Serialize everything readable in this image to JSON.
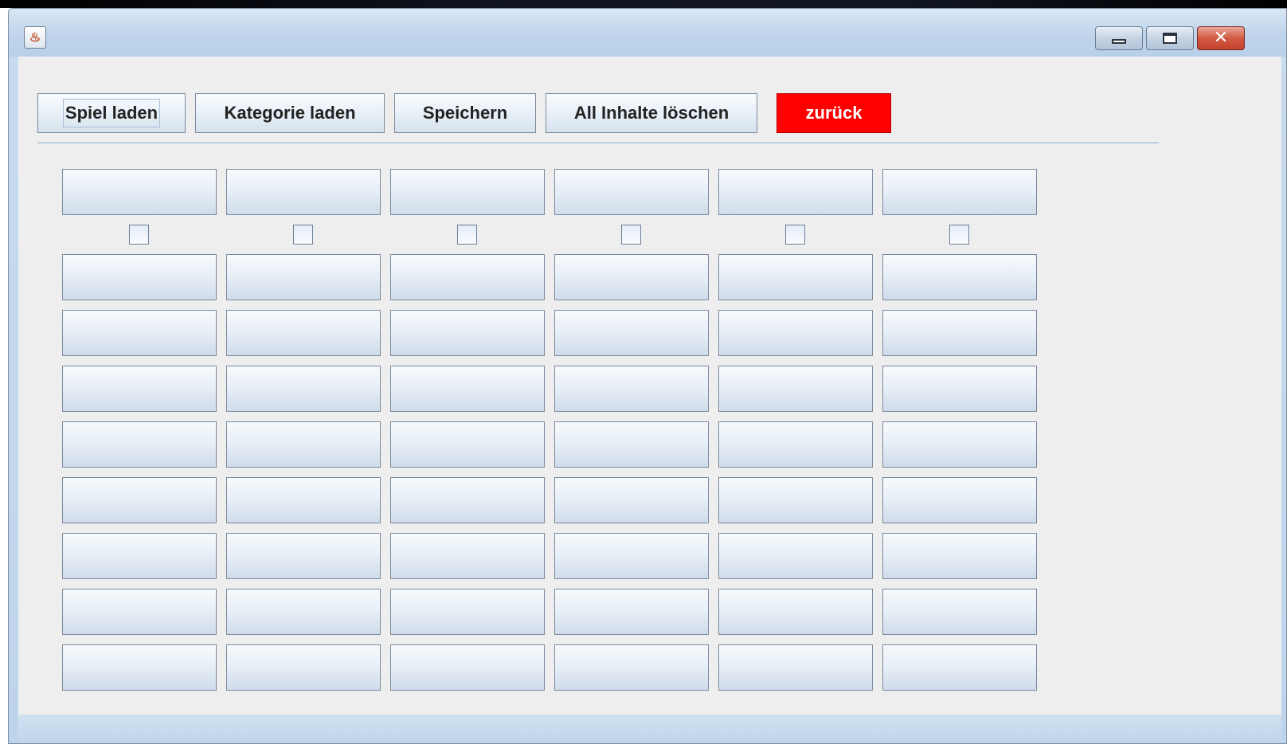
{
  "window": {
    "app_icon": "java-cup-icon",
    "controls": [
      "minimize-icon",
      "maximize-icon",
      "close-icon"
    ]
  },
  "toolbar": {
    "load_game_label": "Spiel laden",
    "load_category_label": "Kategorie laden",
    "save_label": "Speichern",
    "clear_all_label": "All Inhalte löschen",
    "back_label": "zurück",
    "back_color": "#ff0000"
  },
  "grid": {
    "columns": 6,
    "rows": 8,
    "header_checkboxes_checked": [
      false,
      false,
      false,
      false,
      false,
      false
    ]
  }
}
